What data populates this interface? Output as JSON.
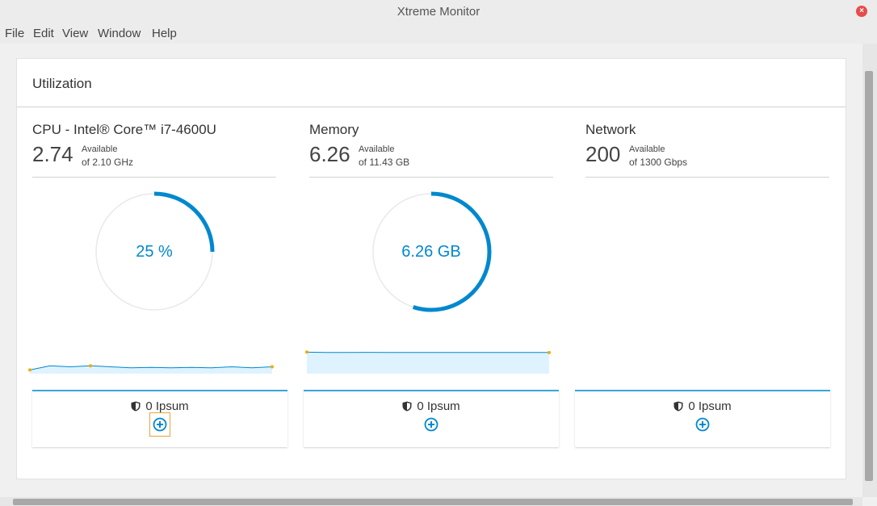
{
  "window": {
    "title": "Xtreme Monitor",
    "close_symbol": "×"
  },
  "menu": [
    "File",
    "Edit",
    "View",
    "Window",
    "Help"
  ],
  "card_title": "Utilization",
  "colors": {
    "accent": "#0088ce",
    "ring": "#e9e9e9",
    "card_border": "#39a5dc",
    "spark_fill": "#def3ff",
    "spark_dot": "#f0ab00"
  },
  "columns": [
    {
      "name": "CPU - Intel® Core™ i7-4600U",
      "value": "2.74",
      "available_label": "Available",
      "of_text": "of 2.10 GHz",
      "donut_label": "25 %",
      "donut_fraction": 0.25,
      "spark": [
        0.1,
        0.3,
        0.25,
        0.3,
        0.25,
        0.2,
        0.22,
        0.2,
        0.22,
        0.2,
        0.25,
        0.2,
        0.25
      ],
      "footer": {
        "count_text": "0 Ipsum"
      }
    },
    {
      "name": "Memory",
      "value": "6.26",
      "available_label": "Available",
      "of_text": "of 11.43 GB",
      "donut_label": "6.26 GB",
      "donut_fraction": 0.55,
      "spark": [
        0.95,
        0.93,
        0.93,
        0.94,
        0.93,
        0.93,
        0.93,
        0.93,
        0.93,
        0.93,
        0.93,
        0.93,
        0.93
      ],
      "footer": {
        "count_text": "0 Ipsum"
      }
    },
    {
      "name": "Network",
      "value": "200",
      "available_label": "Available",
      "of_text": "of 1300 Gbps",
      "donut_label": "",
      "donut_fraction": null,
      "spark": null,
      "footer": {
        "count_text": "0 Ipsum"
      }
    }
  ]
}
